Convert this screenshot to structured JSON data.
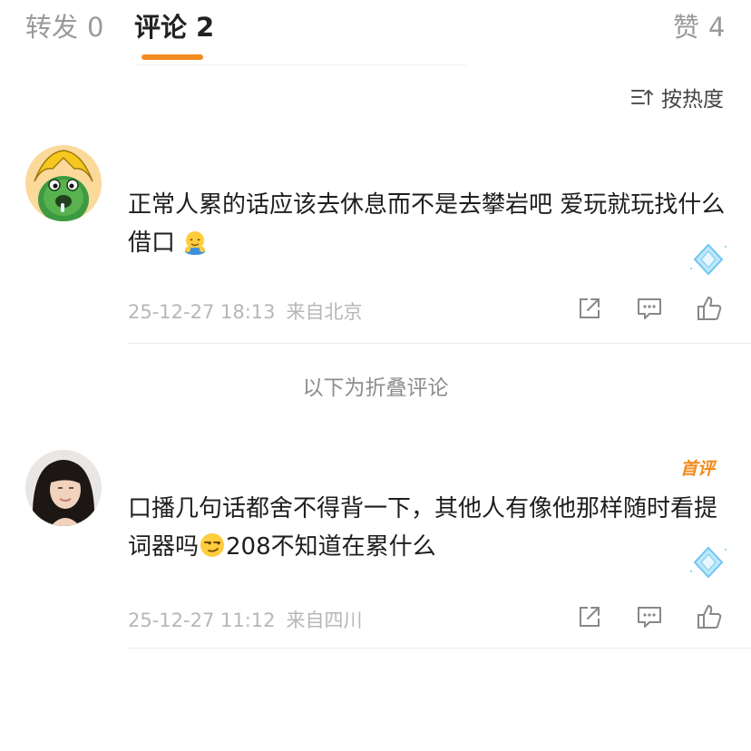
{
  "tabs": {
    "repost": {
      "label": "转发",
      "count": "0"
    },
    "comments": {
      "label": "评论",
      "count": "2"
    },
    "likes": {
      "label": "赞",
      "count": "4"
    }
  },
  "sort": {
    "label": "按热度",
    "icon": "sort-icon"
  },
  "comments": [
    {
      "text_before": "正常人累的话应该去休息而不是去攀岩吧 爱玩就玩找什么借口",
      "text_after": "",
      "emoji": "hugging-face",
      "date": "25-12-27 18:13",
      "location": "来自北京"
    },
    {
      "badge": "首评",
      "text_before": "口播几句话都舍不得背一下，其他人有像他那样随时看提词器吗",
      "text_after": "208不知道在累什么",
      "emoji": "smirking-face",
      "date": "25-12-27 11:12",
      "location": "来自四川"
    }
  ],
  "folded_label": "以下为折叠评论",
  "colors": {
    "accent": "#f28b1e",
    "meta": "#b7b7b7",
    "gem": "#6ec6ef"
  }
}
